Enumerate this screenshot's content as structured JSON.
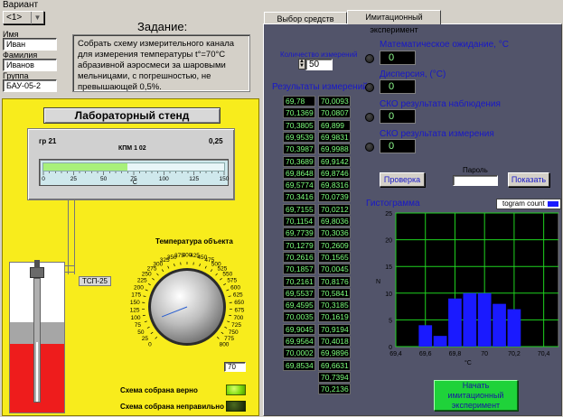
{
  "variant": {
    "label": "Вариант",
    "value": "<1>"
  },
  "form": {
    "name_label": "Имя",
    "name_value": "Иван",
    "surname_label": "Фамилия",
    "surname_value": "Иванов",
    "group_label": "Группа",
    "group_value": "БАУ-05-2"
  },
  "task": {
    "title": "Задание:",
    "text": "Собрать схему измерительного канала для измерения температуры t°=70°С абразивной аэросмеси за шаровыми мельницами, с погрешностью, не превышающей 0,5%."
  },
  "stand": {
    "title": "Лабораторный стенд",
    "instrument": {
      "grade": "гр 21",
      "class": "0,25",
      "model": "КПМ 1 02",
      "unit": "°С",
      "ticks": [
        "0",
        "25",
        "50",
        "75",
        "100",
        "125",
        "150"
      ],
      "bar_value": 70,
      "bar_max": 150
    },
    "sensor_label": "ТСП-25",
    "knob": {
      "title": "Температура объекта",
      "ticks": [
        "0",
        "25",
        "50",
        "75",
        "100",
        "125",
        "150",
        "175",
        "200",
        "225",
        "250",
        "275",
        "300",
        "325",
        "350",
        "375",
        "400",
        "425",
        "450",
        "475",
        "500",
        "525",
        "550",
        "575",
        "600",
        "625",
        "650",
        "675",
        "700",
        "725",
        "750",
        "775",
        "800"
      ],
      "value": 70,
      "min": 0,
      "max": 800,
      "input_value": "70"
    },
    "status_ok": "Схема собрана верно",
    "status_bad": "Схема собрана неправильно"
  },
  "tabs": [
    "Выбор средств измерения",
    "Имитационный эксперимент"
  ],
  "experiment": {
    "count_label": "Количество измерений",
    "count_value": "50",
    "results_label": "Результаты измерений",
    "results_col1": [
      "69,78",
      "70,1369",
      "70,3805",
      "69,9539",
      "70,3987",
      "70,3689",
      "69,8648",
      "69,5774",
      "70,3416",
      "69,7155",
      "70,1154",
      "69,7739",
      "70,1279",
      "70,2616",
      "70,1857",
      "70,2161",
      "69,5537",
      "69,4595",
      "70,0035",
      "69,9045",
      "69,9564",
      "70,0002",
      "69,8534"
    ],
    "results_col2": [
      "70,0093",
      "70,0807",
      "69,899",
      "69,9831",
      "69,9988",
      "69,9142",
      "69,8746",
      "69,8316",
      "70,0739",
      "70,0212",
      "69,8036",
      "70,3036",
      "70,2609",
      "70,1565",
      "70,0045",
      "70,8176",
      "70,5841",
      "70,3185",
      "70,1619",
      "70,9194",
      "70,4018",
      "69,9896",
      "69,6631",
      "70,7394",
      "70,2136"
    ],
    "stats": [
      {
        "label": "Математическое ожидание, °С",
        "value": "0"
      },
      {
        "label": "Дисперсия, (°С)",
        "value": "0"
      },
      {
        "label": "СКО результата наблюдения",
        "value": "0"
      },
      {
        "label": "СКО результата измерения",
        "value": "0"
      }
    ],
    "check_button": "Проверка",
    "password_label": "Пароль",
    "password_value": "",
    "show_button": "Показать",
    "histogram_label": "Гистограмма",
    "histogram_legend": "togram count",
    "start_button": "Начать имитационный эксперимент"
  },
  "chart_data": {
    "type": "bar",
    "title": "",
    "xlabel": "°С",
    "ylabel": "N",
    "x_ticks": [
      "69,4",
      "69,6",
      "69,8",
      "70",
      "70,2",
      "70,4"
    ],
    "y_ticks": [
      "0",
      "5",
      "10",
      "15",
      "20",
      "25"
    ],
    "xlim": [
      69.4,
      70.5
    ],
    "ylim": [
      0,
      25
    ],
    "bins": [
      69.5,
      69.6,
      69.7,
      69.8,
      69.9,
      70.0,
      70.1,
      70.2,
      70.3
    ],
    "bin_width": 0.09,
    "values": [
      0,
      4,
      2,
      9,
      10,
      10,
      8,
      7,
      0
    ],
    "series_color": "#1a1aff",
    "grid": true,
    "background": "#000000",
    "grid_color": "#1fd21f"
  }
}
